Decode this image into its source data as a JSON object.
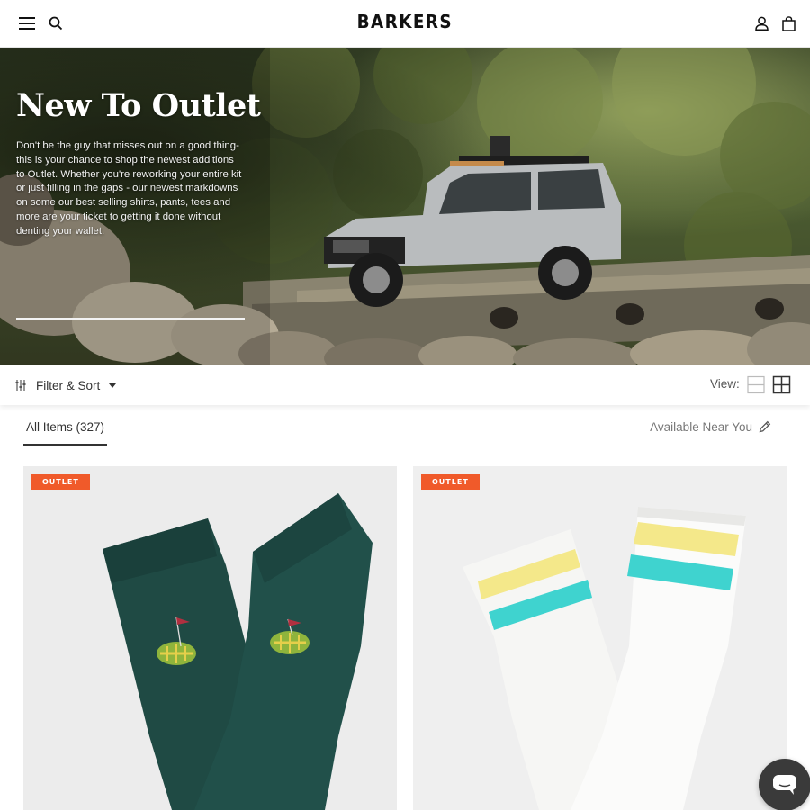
{
  "header": {
    "logo": "BARKERS",
    "icons": [
      "menu-icon",
      "search-icon",
      "account-icon",
      "bag-icon"
    ]
  },
  "hero": {
    "title": "New To Outlet",
    "description": "Don't be the guy that misses out on a good thing- this is your chance to shop the newest additions to Outlet. Whether you're reworking your entire kit or just filling in the gaps - our newest markdowns on some our best selling shirts, pants, tees and more are your ticket to getting it done without denting your wallet."
  },
  "filter_bar": {
    "filter_label": "Filter & Sort",
    "view_label": "View:"
  },
  "tabs": {
    "all_items_label": "All Items (327)",
    "available_near_you_label": "Available Near You"
  },
  "products": [
    {
      "badge": "OUTLET"
    },
    {
      "badge": "OUTLET"
    }
  ],
  "colors": {
    "badge": "#f05a2a",
    "sock_green": "#1f4a44",
    "stripe_yellow": "#f4e88a",
    "stripe_teal": "#3fd3cf",
    "chat_button": "#3a3a3a"
  }
}
